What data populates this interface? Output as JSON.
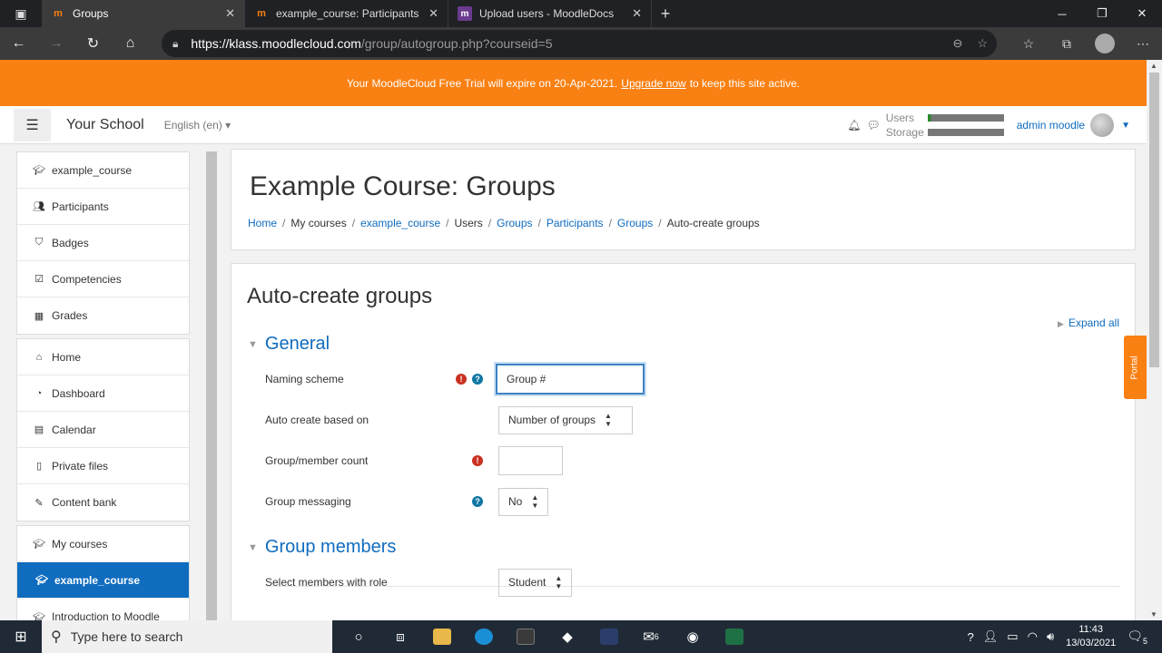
{
  "browser": {
    "tabs": [
      {
        "title": "Groups",
        "favicon": "moodle-icon",
        "active": true
      },
      {
        "title": "example_course: Participants",
        "favicon": "moodle-icon",
        "active": false
      },
      {
        "title": "Upload users - MoodleDocs",
        "favicon": "moodledocs-icon",
        "active": false
      }
    ],
    "url_host": "https://klass.moodlecloud.com",
    "url_path": "/group/autogroup.php?courseid=5"
  },
  "banner": {
    "text_before": "Your MoodleCloud Free Trial will expire on 20-Apr-2021.",
    "link": "Upgrade now",
    "text_after": "to keep this site active."
  },
  "navbar": {
    "site_name": "Your School",
    "language": "English (en)",
    "quota_users_label": "Users",
    "quota_storage_label": "Storage",
    "user_name": "admin moodle"
  },
  "sidebar": {
    "group1": [
      {
        "label": "example_course",
        "icon": "graduation-cap-icon"
      },
      {
        "label": "Participants",
        "icon": "users-icon"
      },
      {
        "label": "Badges",
        "icon": "shield-icon"
      },
      {
        "label": "Competencies",
        "icon": "checkbox-icon"
      },
      {
        "label": "Grades",
        "icon": "table-icon"
      }
    ],
    "group2": [
      {
        "label": "Home",
        "icon": "home-icon"
      },
      {
        "label": "Dashboard",
        "icon": "dashboard-icon"
      },
      {
        "label": "Calendar",
        "icon": "calendar-icon"
      },
      {
        "label": "Private files",
        "icon": "file-icon"
      },
      {
        "label": "Content bank",
        "icon": "paintbrush-icon"
      }
    ],
    "group3": [
      {
        "label": "My courses",
        "icon": "graduation-cap-icon"
      },
      {
        "label": "example_course",
        "icon": "graduation-cap-icon",
        "active": true
      },
      {
        "label": "Introduction to Moodle",
        "icon": "graduation-cap-icon"
      }
    ]
  },
  "header": {
    "title": "Example Course: Groups",
    "breadcrumb": [
      {
        "label": "Home",
        "link": true
      },
      {
        "label": "My courses",
        "link": false
      },
      {
        "label": "example_course",
        "link": true
      },
      {
        "label": "Users",
        "link": false
      },
      {
        "label": "Groups",
        "link": true
      },
      {
        "label": "Participants",
        "link": true
      },
      {
        "label": "Groups",
        "link": true
      },
      {
        "label": "Auto-create groups",
        "link": false
      }
    ]
  },
  "form": {
    "title": "Auto-create groups",
    "expand_all": "Expand all",
    "general_legend": "General",
    "naming_label": "Naming scheme",
    "naming_value": "Group #",
    "auto_create_label": "Auto create based on",
    "auto_create_value": "Number of groups",
    "count_label": "Group/member count",
    "messaging_label": "Group messaging",
    "messaging_value": "No",
    "members_legend": "Group members",
    "role_label": "Select members with role",
    "role_value": "Student"
  },
  "portal": "Portal",
  "taskbar": {
    "search_placeholder": "Type here to search",
    "mail_badge": "6",
    "time": "11:43",
    "date": "13/03/2021",
    "notif_count": "5"
  },
  "colors": {
    "brand_orange": "#f98012",
    "link_blue": "#0f6cbf",
    "required_red": "#ca3120",
    "help_blue": "#1177a3"
  }
}
